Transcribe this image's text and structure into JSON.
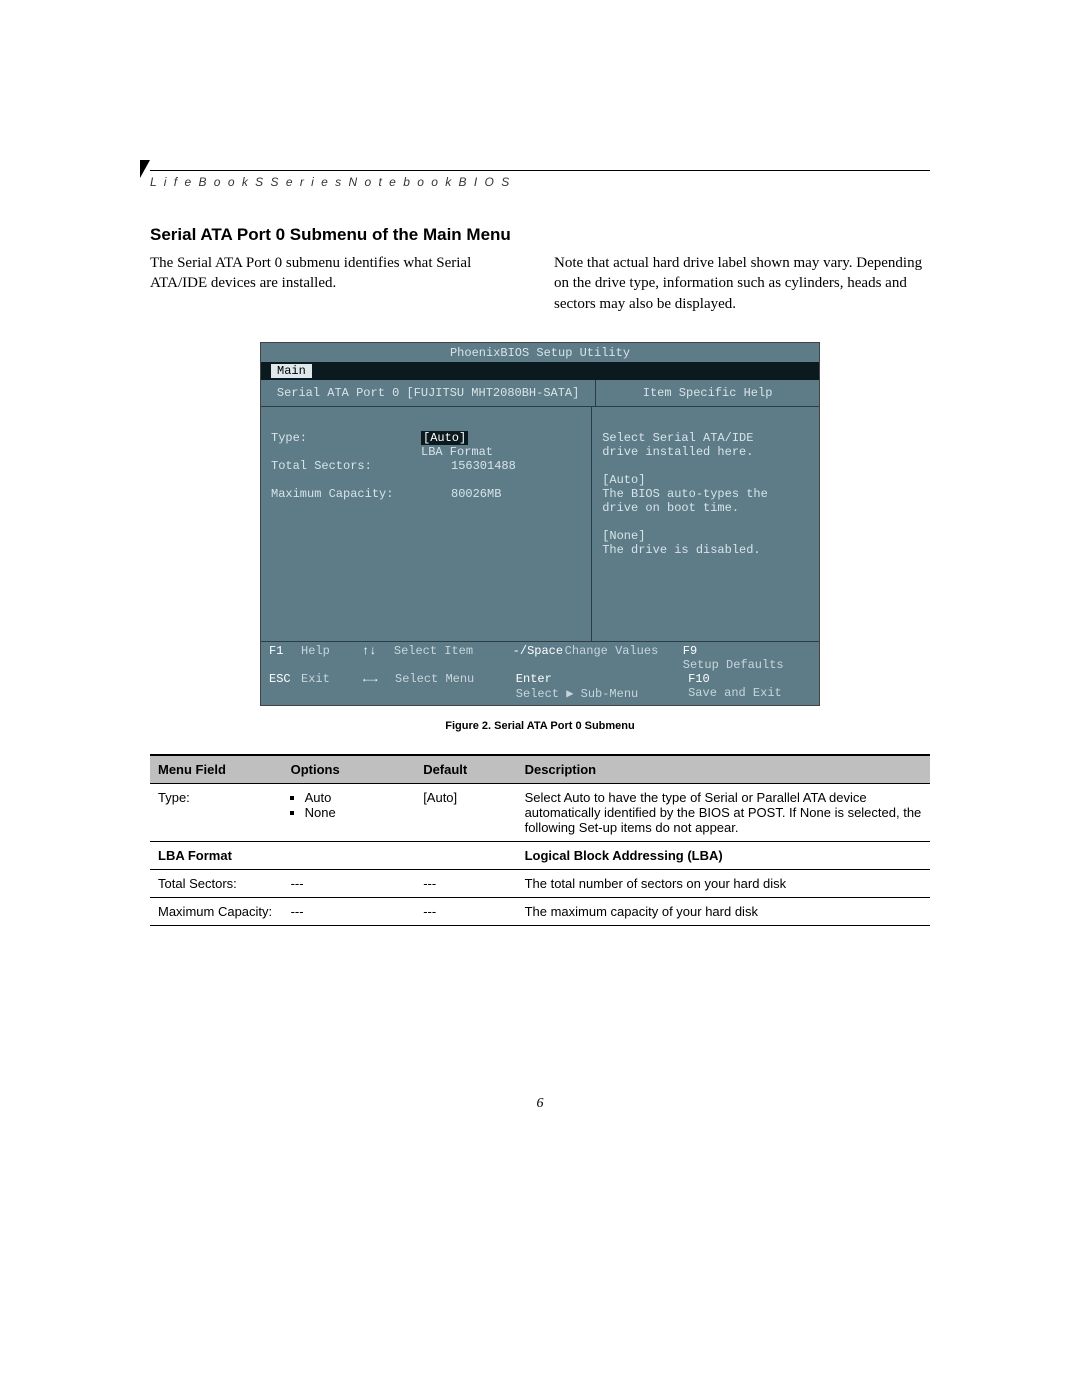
{
  "running_head": "L i f e B o o k   S   S e r i e s   N o t e b o o k   B I O S",
  "section_title": "Serial ATA Port 0 Submenu of the Main Menu",
  "intro_left": "The Serial ATA Port 0 submenu identifies what Serial ATA/IDE devices are installed.",
  "intro_right": "Note that actual hard drive label shown may vary. Depending on the drive type, information such as cylinders, heads and sectors may also be displayed.",
  "bios": {
    "title": "PhoenixBIOS Setup Utility",
    "tabs": {
      "active": "Main"
    },
    "left_heading": "Serial ATA Port 0 [FUJITSU MHT2080BH-SATA]",
    "right_heading": "Item Specific Help",
    "rows": {
      "type_label": "Type:",
      "type_value": "[Auto]",
      "lba_label": "LBA Format",
      "sectors_label": "Total Sectors:",
      "sectors_value": "156301488",
      "capacity_label": "Maximum Capacity:",
      "capacity_value": "80026MB"
    },
    "help": {
      "l1": "Select Serial ATA/IDE",
      "l2": "drive installed here.",
      "l3": "[Auto]",
      "l4": "The BIOS auto-types the",
      "l5": "drive on boot time.",
      "l6": "[None]",
      "l7": "The drive is disabled."
    },
    "footer": {
      "f1_key": "F1",
      "f1_act": "Help",
      "arrows_ud_key": "↑↓",
      "arrows_ud_act": "Select Item",
      "space_key": "-/Space",
      "space_act": "Change Values",
      "f9_key": "F9",
      "f9_act": "Setup Defaults",
      "esc_key": "ESC",
      "esc_act": "Exit",
      "arrows_lr_key": "←→",
      "arrows_lr_act": "Select Menu",
      "enter_key": "Enter",
      "enter_act": "Select ▶ Sub-Menu",
      "f10_key": "F10",
      "f10_act": "Save and Exit"
    }
  },
  "figure_caption": "Figure 2.  Serial ATA Port 0 Submenu",
  "table": {
    "headers": {
      "menu": "Menu Field",
      "options": "Options",
      "def": "Default",
      "desc": "Description"
    },
    "r1": {
      "menu": "Type:",
      "opt1": "Auto",
      "opt2": "None",
      "def": "[Auto]",
      "desc": "Select Auto to have the type of Serial or Parallel ATA device automatically identified by the BIOS at POST. If None is selected, the following Set-up items do not appear."
    },
    "r2": {
      "menu": "LBA Format",
      "desc": "Logical Block Addressing (LBA)"
    },
    "r3": {
      "menu": "Total Sectors:",
      "opts": "---",
      "def": "---",
      "desc": "The total number of sectors on your hard disk"
    },
    "r4": {
      "menu": "Maximum Capacity:",
      "opts": "---",
      "def": "---",
      "desc": "The maximum capacity of your hard disk"
    }
  },
  "page_number": "6"
}
